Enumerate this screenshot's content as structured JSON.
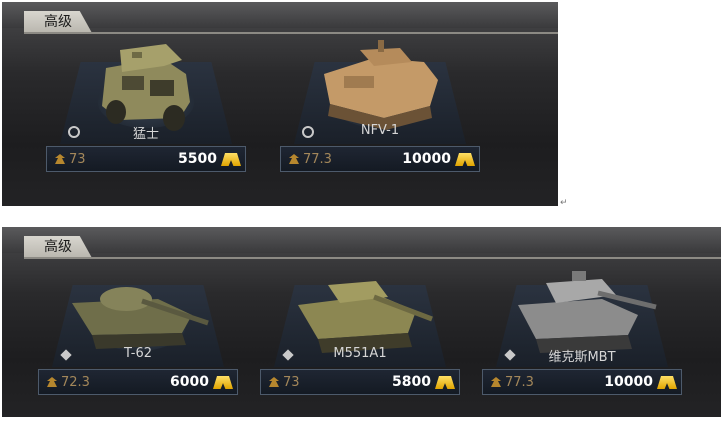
{
  "panels": [
    {
      "header": "高级",
      "cards": [
        {
          "name": "猛士",
          "indicator": "circle",
          "rank": "73",
          "price": "5500",
          "vehicle_icon": "humvee-icon"
        },
        {
          "name": "NFV-1",
          "indicator": "circle",
          "rank": "77.3",
          "price": "10000",
          "vehicle_icon": "ifv-icon"
        }
      ]
    },
    {
      "header": "高级",
      "cards": [
        {
          "name": "T-62",
          "indicator": "diamond",
          "rank": "72.3",
          "price": "6000",
          "vehicle_icon": "tank-icon"
        },
        {
          "name": "M551A1",
          "indicator": "diamond",
          "rank": "73",
          "price": "5800",
          "vehicle_icon": "light-tank-icon"
        },
        {
          "name": "维克斯MBT",
          "indicator": "diamond",
          "rank": "77.3",
          "price": "10000",
          "vehicle_icon": "tank-icon"
        }
      ]
    }
  ],
  "marks": {
    "return": "↵"
  },
  "colors": {
    "gold": "#f2c200",
    "rank": "#a3875a",
    "panel": "#1d1d1f"
  }
}
